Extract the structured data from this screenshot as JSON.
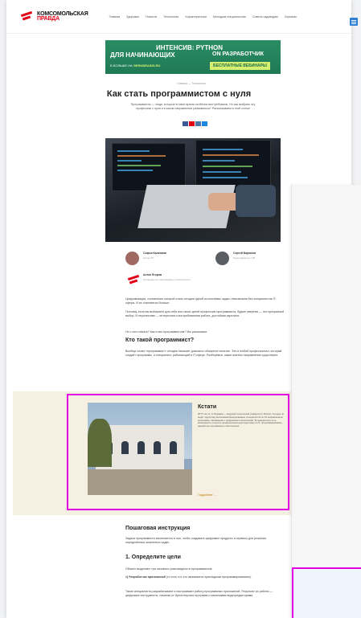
{
  "brand": {
    "line1": "КОМСОМОЛЬСКАЯ",
    "line2": "ПРАВДА",
    "line3": "Вашего"
  },
  "nav": [
    "Главная",
    "Здоровье",
    "Новости",
    "Технологии",
    "Характеристики",
    "Молодым специалистам",
    "Советы садоводам",
    "Сериалы"
  ],
  "banner": {
    "line1": "ИНТЕНСИВ: PYTHON",
    "line2": "ДЛЯ НАЧИНАЮЩИХ",
    "line3": "ON РАЗРАБОТЧИК",
    "link_prefix": "В БОЛЬШЕ НА",
    "link": "GEEKBRAINS.RU",
    "button": "БЕСПЛАТНЫЕ ВЕБИНАРЫ",
    "bg": "#1f7a55",
    "accent": "#d5f070"
  },
  "breadcrumb": "Главная — Технологии",
  "article": {
    "title": "Как стать программистом с нуля",
    "lead": "Программисты — люди, которые в наше время особенно востребованы. Но как выбрать эту профессию с нуля и в каком направлении развиваться? Рассказываем в этой статье"
  },
  "share_colors": [
    "#3b5998",
    "#e30016",
    "#4a76a8",
    "#1e88e5"
  ],
  "authors": [
    {
      "name": "Софья Калинина",
      "role": "Автор КП"
    },
    {
      "name": "Сергей Бирюков",
      "role": "Преподаватель GB"
    },
    {
      "name": "Антон Егоров",
      "role": "Руководитель программного обеспечения"
    }
  ],
  "paragraphs": [
    "Цифровизация, стремление которой стало сегодня одной из ключевых задач, невозможна без специалистов IT-сферы. И их становится больше.",
    "Поэтому, если вы выбираете для себя или своих детей профессию программиста, будьте уверены — это прекрасный выбор. В перспективе — интересная и востребованная работа, достойная зарплата.",
    "Но с чего начать? Как стать программистом? Мы расскажем."
  ],
  "section1": {
    "heading": "Кто такой программист?",
    "text": "Вообще слово «программист» сегодня означает довольно обширное понятие. Это и любой профессионал, который создаёт программы, и специалист, работающий в IT-сфере. Разберёмся, какие именно направления существуют."
  },
  "facts": {
    "title": "Кстати",
    "text": "МГТУ им. Н. Э. Баумана — ведущий технический университет России. Сегодня он ведёт подготовку высококвалифицированных специалистов по 19 направлениям программы, связанными с цифровыми технологиями. В университете есть возможность получить профессиональную подготовку по IT, программированию, разработке программного обеспечения.",
    "more": "Подробнее →"
  },
  "section2": {
    "heading": "Пошаговая инструкция",
    "text": "Задача программиста заключается в том, чтобы создавать цифровые продукты и сервисы для решения определённых жизненных задач."
  },
  "section3": {
    "heading": "1. Определите цели",
    "intro": "Обычно выделяют три основных разновидности программистов:",
    "item_label": "1) Разработчик приложений",
    "item_text": "(то есть тот, кто занимается прикладным программированием).",
    "body": "Такие специалисты разрабатывают и настраивают работу программных приложений. Результат их работы — цифровые инструменты, начиная от бухгалтерских программ и заканчивая видеоредакторами."
  }
}
